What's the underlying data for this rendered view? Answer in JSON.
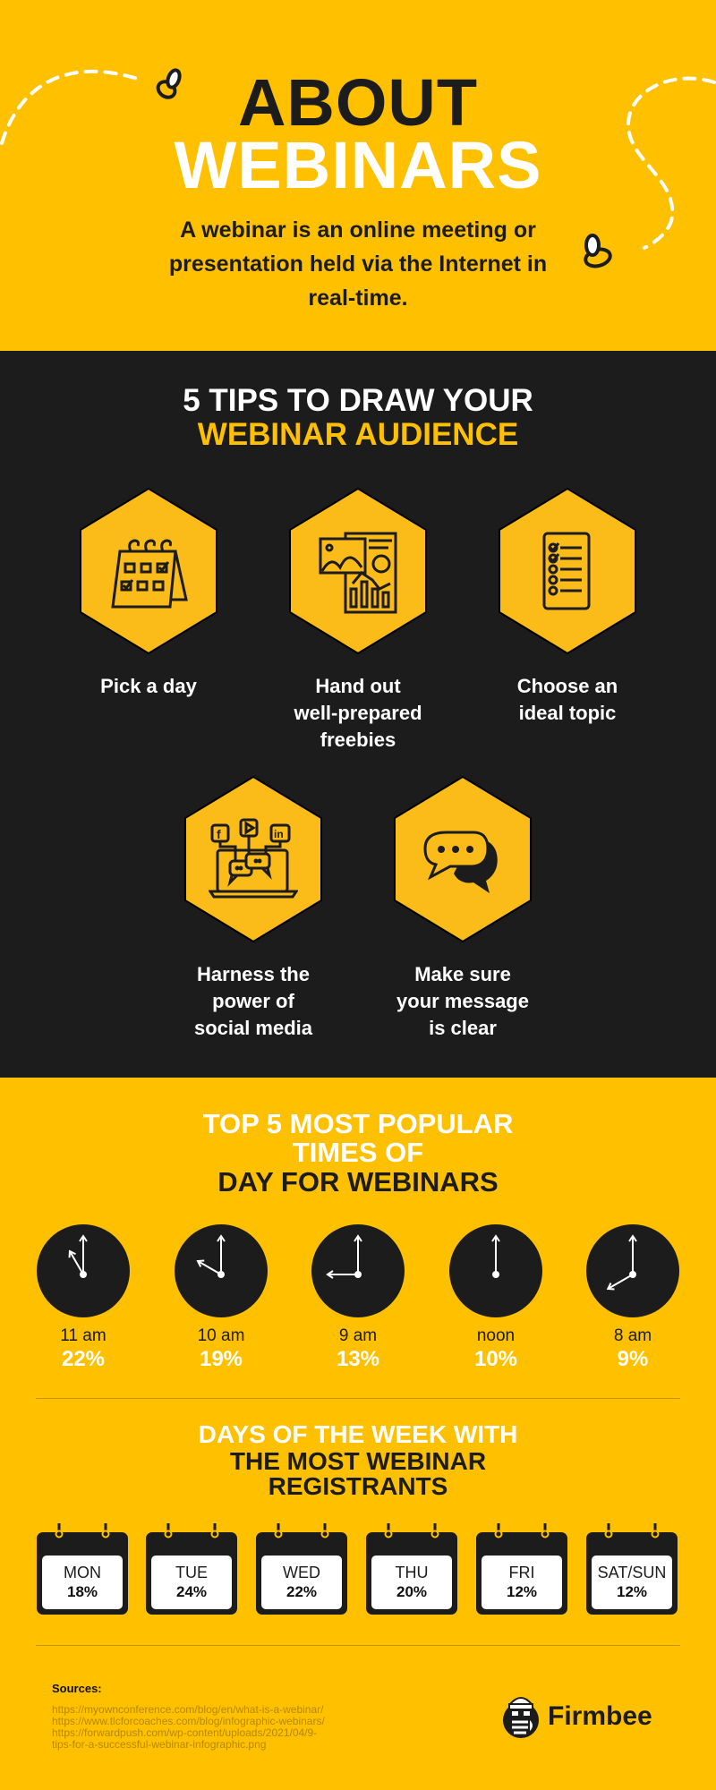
{
  "hero": {
    "title_line1": "ABOUT",
    "title_line2": "WEBINARS",
    "description": "A webinar is an online meeting or presentation held via the Internet in real-time.",
    "decorations": [
      "bee-icon",
      "bee-icon",
      "dashed-flight-path"
    ]
  },
  "tips": {
    "heading_line1": "5 TIPS TO DRAW YOUR",
    "heading_line2": "WEBINAR AUDIENCE",
    "items": [
      {
        "icon": "desk-calendar-icon",
        "label_lines": [
          "Pick a day"
        ]
      },
      {
        "icon": "documents-chart-icon",
        "label_lines": [
          "Hand out",
          "well-prepared",
          "freebies"
        ]
      },
      {
        "icon": "checklist-icon",
        "label_lines": [
          "Choose an",
          "ideal topic"
        ]
      },
      {
        "icon": "social-media-laptop-icon",
        "label_lines": [
          "Harness the",
          "power of",
          "social media"
        ]
      },
      {
        "icon": "chat-bubbles-icon",
        "label_lines": [
          "Make sure",
          "your message",
          "is clear"
        ]
      }
    ]
  },
  "times": {
    "heading_line1": "TOP 5 MOST POPULAR",
    "heading_line2": "TIMES OF",
    "heading_line3": "DAY FOR WEBINARS",
    "items": [
      {
        "label": "11 am",
        "value": "22%",
        "hour": 11
      },
      {
        "label": "10 am",
        "value": "19%",
        "hour": 10
      },
      {
        "label": "9 am",
        "value": "13%",
        "hour": 9
      },
      {
        "label": "noon",
        "value": "10%",
        "hour": 12
      },
      {
        "label": "8 am",
        "value": "9%",
        "hour": 8
      }
    ]
  },
  "days": {
    "heading_line1": "DAYS OF THE WEEK WITH",
    "heading_line2": "THE MOST WEBINAR",
    "heading_line3": "REGISTRANTS",
    "items": [
      {
        "day": "MON",
        "value": "18%"
      },
      {
        "day": "TUE",
        "value": "24%"
      },
      {
        "day": "WED",
        "value": "22%"
      },
      {
        "day": "THU",
        "value": "20%"
      },
      {
        "day": "FRI",
        "value": "12%"
      },
      {
        "day": "SAT/SUN",
        "value": "12%"
      }
    ]
  },
  "footer": {
    "sources_heading": "Sources:",
    "sources": [
      "https://myownconference.com/blog/en/what-is-a-webinar/",
      "https://www.tlcforcoaches.com/blog/infographic-webinars/",
      "https://forwardpush.com/wp-content/uploads/2021/04/9-",
      "tips-for-a-successful-webinar-infographic.png"
    ],
    "brand_name": "Firmbee"
  },
  "colors": {
    "brand_yellow": "#FFC000",
    "hex_yellow": "#FBBC1A",
    "dark": "#1C1C1C",
    "white": "#FFFFFF"
  }
}
